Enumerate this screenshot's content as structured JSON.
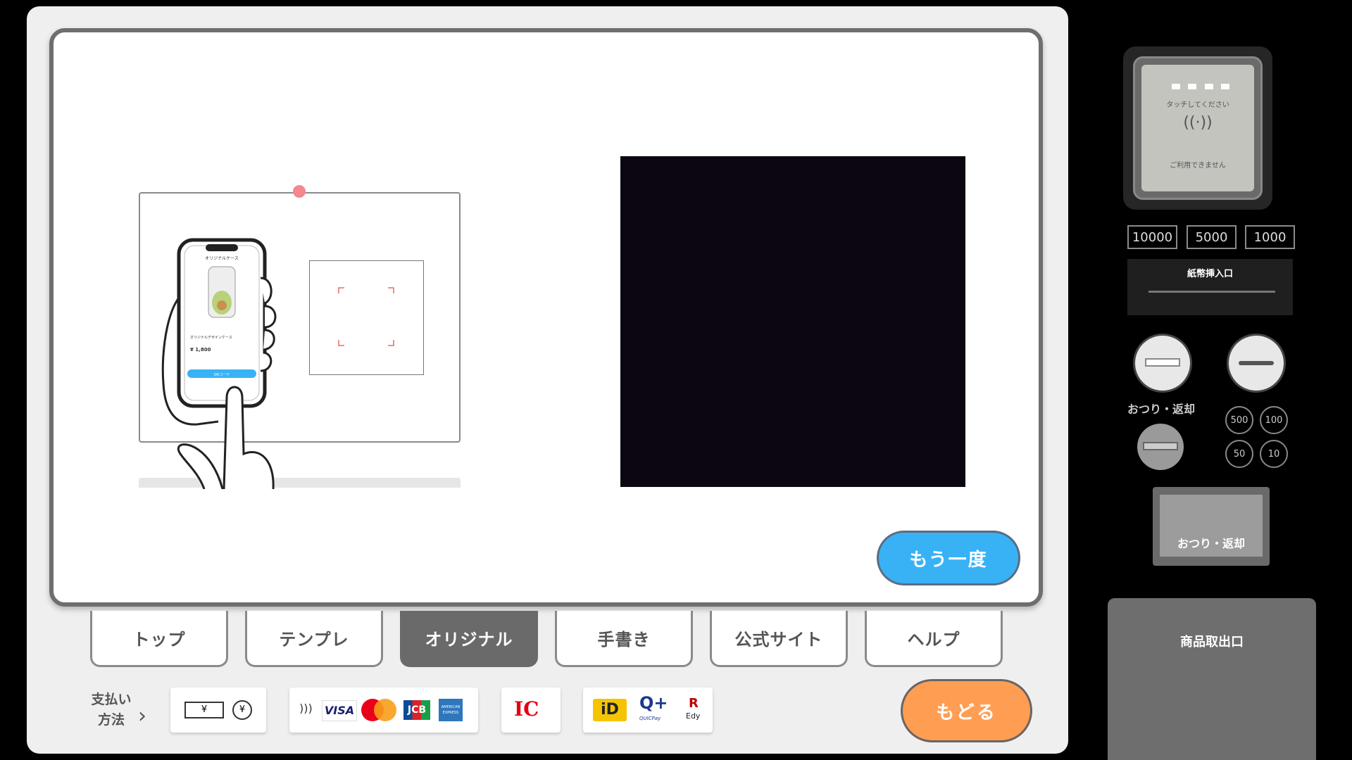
{
  "buttons": {
    "retry": "もう一度",
    "back": "もどる"
  },
  "tabs": [
    {
      "label": "トップ"
    },
    {
      "label": "テンプレ"
    },
    {
      "label": "オリジナル",
      "active": true
    },
    {
      "label": "手書き"
    },
    {
      "label": "公式サイト"
    },
    {
      "label": "ヘルプ"
    }
  ],
  "payment": {
    "label_line1": "支払い",
    "label_line2": "方法",
    "cash_yen": "¥",
    "coin_yen": "¥",
    "card_brands": [
      "VISA",
      "JCB",
      "AMERICAN EXPRESS"
    ],
    "ic": "IC",
    "id": "iD",
    "quicpay": "Q+",
    "quicpay_sub": "QUICPay",
    "edy_r": "R",
    "edy": "Edy"
  },
  "illustration": {
    "phone_title": "オリジナルケース",
    "product": "オリジナルデザインケース",
    "price": "¥ 1,800",
    "button": "QRコード"
  },
  "machine": {
    "reader_text1": "タッチしてください",
    "reader_text2": "ご利用できません",
    "bills": [
      "10000",
      "5000",
      "1000"
    ],
    "bill_slot": "紙幣挿入口",
    "change_label": "おつり・返却",
    "coins": [
      "500",
      "100",
      "50",
      "10"
    ],
    "return_button": "おつり・返却",
    "outlet": "商品取出口"
  },
  "colors": {
    "retry": "#38b2f4",
    "back": "#ff9e52",
    "active_tab": "#6a6a6a"
  }
}
